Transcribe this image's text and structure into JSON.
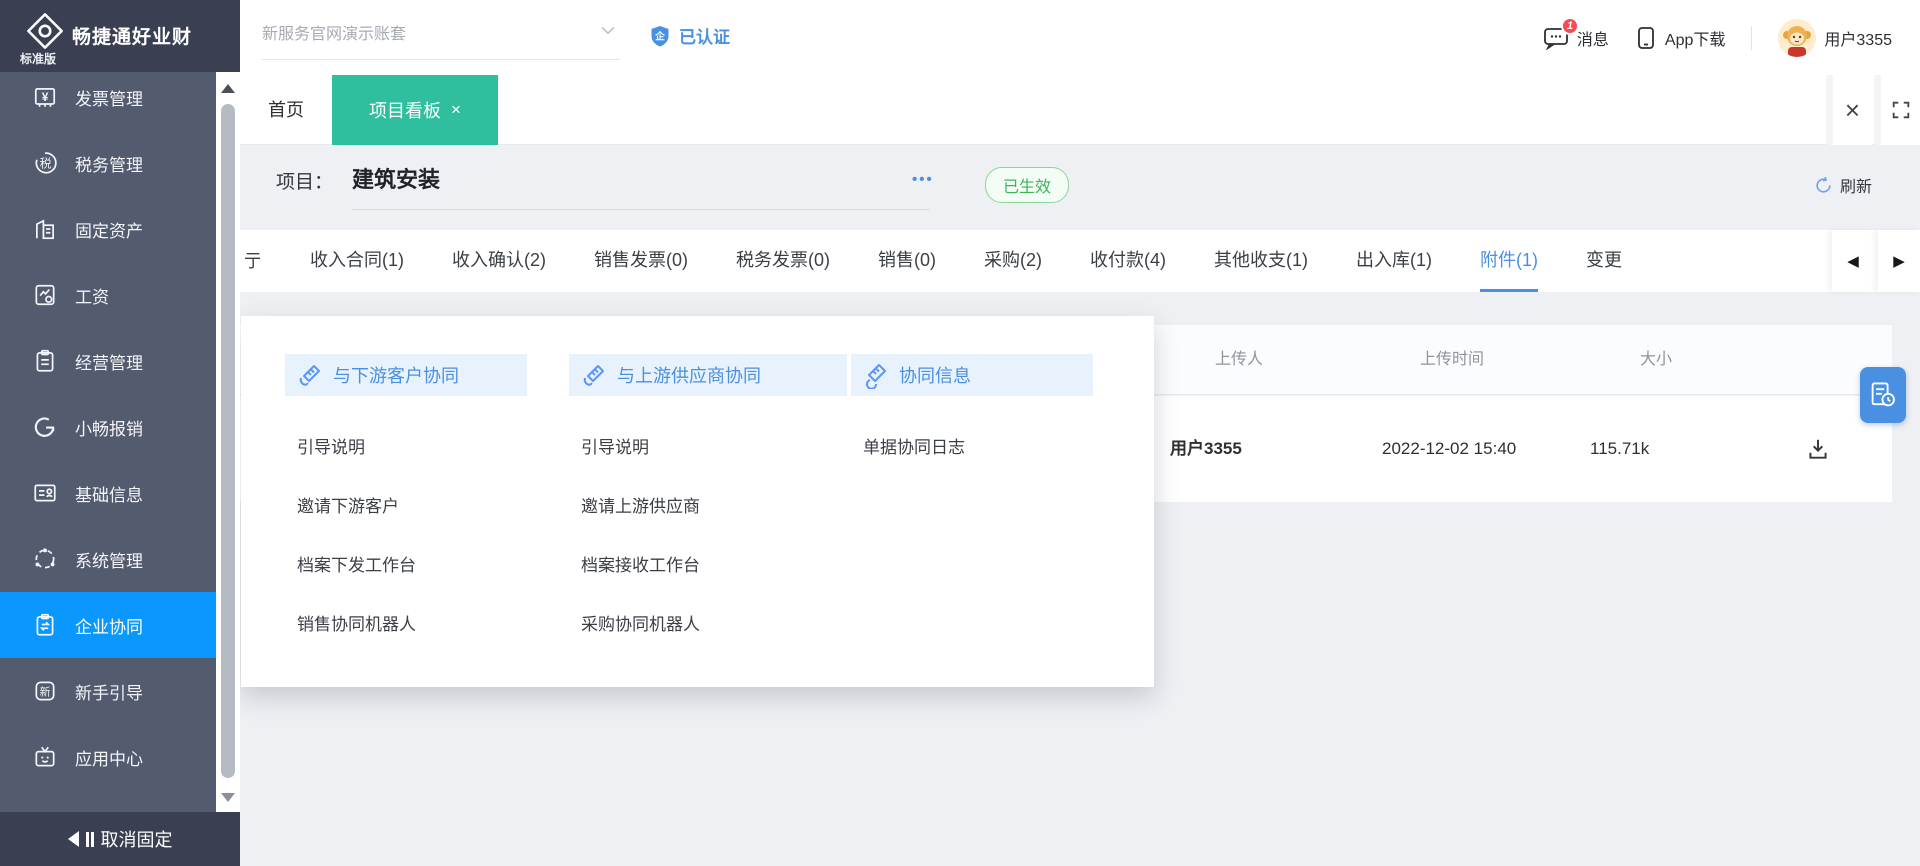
{
  "brand": {
    "name": "畅捷通好业财",
    "edition": "标准版"
  },
  "topbar": {
    "account_selector": "新服务官网演示账套",
    "verified_label": "已认证",
    "messages_label": "消息",
    "messages_badge": "1",
    "app_download_label": "App下载",
    "username": "用户3355"
  },
  "tabs": [
    {
      "label": "首页"
    },
    {
      "label": "项目看板",
      "close": "×"
    }
  ],
  "window_actions": {
    "close": "×"
  },
  "sidebar": {
    "items": [
      {
        "label": "发票管理",
        "icon": "invoice-icon"
      },
      {
        "label": "税务管理",
        "icon": "tax-icon"
      },
      {
        "label": "固定资产",
        "icon": "fixed-assets-icon"
      },
      {
        "label": "工资",
        "icon": "salary-icon"
      },
      {
        "label": "经营管理",
        "icon": "business-icon"
      },
      {
        "label": "小畅报销",
        "icon": "reimburse-icon"
      },
      {
        "label": "基础信息",
        "icon": "base-info-icon"
      },
      {
        "label": "系统管理",
        "icon": "system-icon"
      },
      {
        "label": "企业协同",
        "icon": "collab-icon",
        "active": true
      },
      {
        "label": "新手引导",
        "icon": "guide-icon"
      },
      {
        "label": "应用中心",
        "icon": "app-center-icon"
      }
    ],
    "unpin_label": "取消固定"
  },
  "project": {
    "label": "项目：",
    "name": "建筑安装",
    "status_badge": "已生效",
    "more_label": "•••",
    "refresh_label": "刷新"
  },
  "subtabs": {
    "left_partial": "亍",
    "items": [
      {
        "label": "收入合同(1)"
      },
      {
        "label": "收入确认(2)"
      },
      {
        "label": "销售发票(0)"
      },
      {
        "label": "税务发票(0)"
      },
      {
        "label": "销售(0)"
      },
      {
        "label": "采购(2)"
      },
      {
        "label": "收付款(4)"
      },
      {
        "label": "其他收支(1)"
      },
      {
        "label": "出入库(1)"
      },
      {
        "label": "附件(1)",
        "active": true
      },
      {
        "label": "变更"
      }
    ],
    "arrow_left": "◀",
    "arrow_right": "▶"
  },
  "attachments": {
    "columns": [
      "上传人",
      "上传时间",
      "大小"
    ],
    "rows": [
      {
        "uploader": "用户3355",
        "time": "2022-12-02 15:40",
        "size": "115.71k"
      }
    ]
  },
  "mega_menu": {
    "columns": [
      {
        "title": "与下游客户协同",
        "items": [
          "引导说明",
          "邀请下游客户",
          "档案下发工作台",
          "销售协同机器人"
        ]
      },
      {
        "title": "与上游供应商协同",
        "items": [
          "引导说明",
          "邀请上游供应商",
          "档案接收工作台",
          "采购协同机器人"
        ]
      },
      {
        "title": "协同信息",
        "items": [
          "单据协同日志"
        ]
      }
    ]
  },
  "colors": {
    "accent_blue": "#4a90e2",
    "sidebar_active_blue": "#0a98ff",
    "tab_green": "#2fbf9e",
    "status_green": "#3eb45a",
    "badge_red": "#fa4a4f",
    "sidebar_bg": "#535b6e",
    "sidebar_header_bg": "#3a3f51",
    "content_bg": "#eef0f3"
  }
}
